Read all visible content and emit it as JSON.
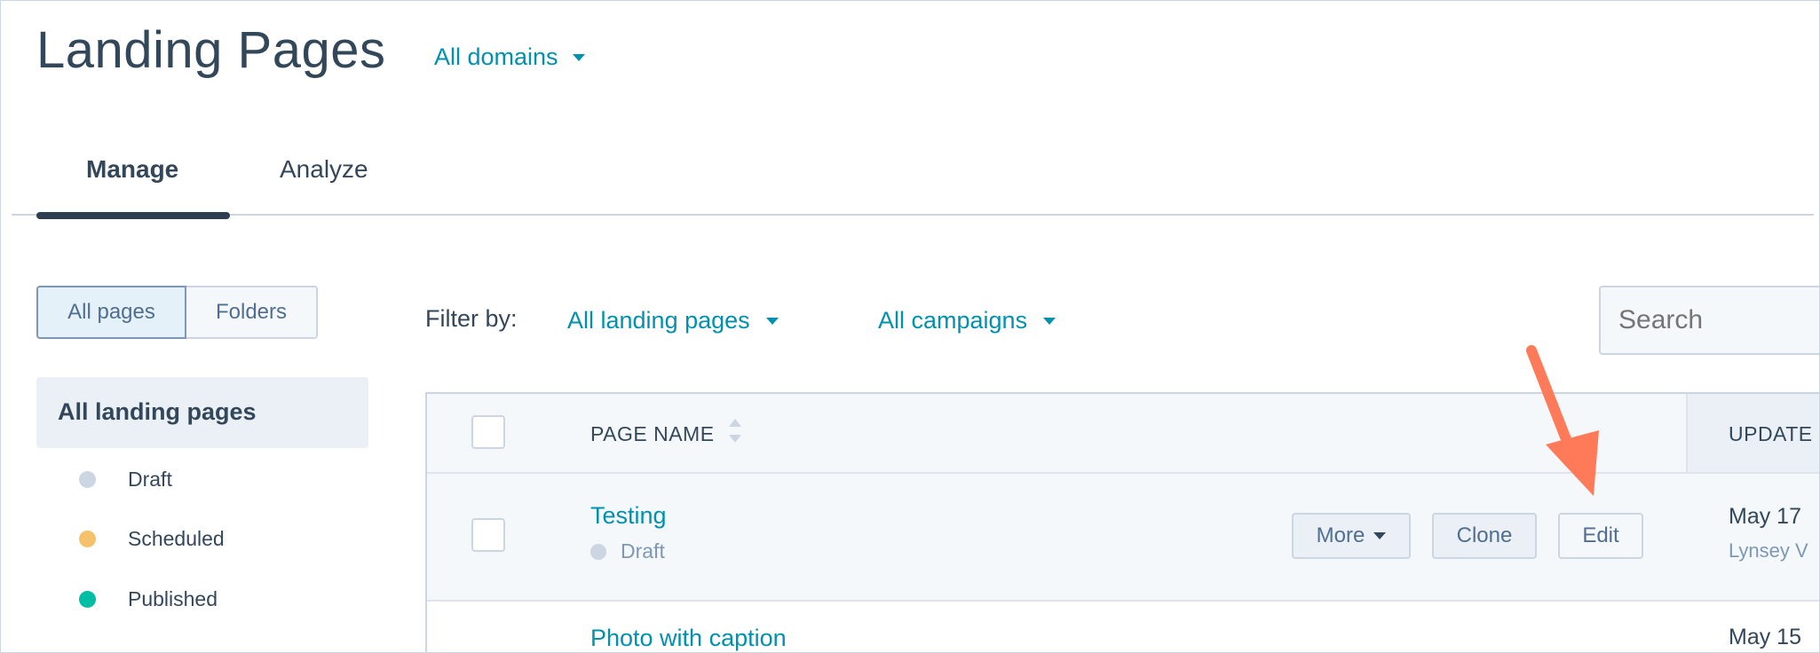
{
  "header": {
    "title": "Landing Pages",
    "domain_filter": "All domains"
  },
  "tabs": [
    {
      "label": "Manage",
      "active": true
    },
    {
      "label": "Analyze",
      "active": false
    }
  ],
  "view_toggle": {
    "all_pages": "All pages",
    "folders": "Folders"
  },
  "sidebar": {
    "heading": "All landing pages",
    "statuses": [
      {
        "label": "Draft",
        "color": "#cbd6e2"
      },
      {
        "label": "Scheduled",
        "color": "#f5c26b"
      },
      {
        "label": "Published",
        "color": "#00bda5"
      }
    ]
  },
  "filters": {
    "label": "Filter by:",
    "pages": "All landing pages",
    "campaigns": "All campaigns",
    "search_placeholder": "Search"
  },
  "table": {
    "columns": {
      "name": "PAGE NAME",
      "updated": "UPDATE"
    },
    "rows": [
      {
        "name": "Testing",
        "status": "Draft",
        "date": "May 17",
        "author": "Lynsey V",
        "actions": {
          "more": "More",
          "clone": "Clone",
          "edit": "Edit"
        }
      },
      {
        "name": "Photo with caption",
        "date": "May 15"
      }
    ]
  },
  "colors": {
    "accent": "#0091ae",
    "text": "#33475b",
    "annotation_arrow": "#ff7a59"
  }
}
